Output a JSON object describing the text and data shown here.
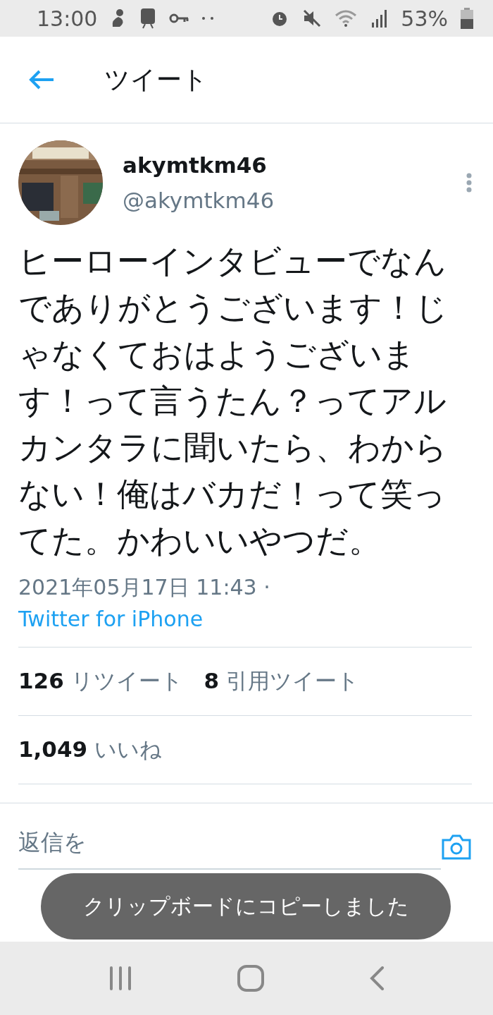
{
  "status_bar": {
    "time": "13:00",
    "battery": "53%"
  },
  "header": {
    "title": "ツイート"
  },
  "tweet": {
    "author": {
      "name": "akymtkm46",
      "handle": "@akymtkm46"
    },
    "text": "ヒーローインタビューでなんでありがとうございます！じゃなくておはようございます！って言うたん？ってアルカンタラに聞いたら、わからない！俺はバカだ！って笑ってた。かわいいやつだ。",
    "timestamp": "2021年05月17日 11:43 ·",
    "source": "Twitter for iPhone",
    "stats": [
      {
        "count": "126",
        "label": "リツイート"
      },
      {
        "count": "8",
        "label": "引用ツイート"
      }
    ],
    "likes": {
      "count": "1,049",
      "label": "いいね"
    }
  },
  "reply": {
    "placeholder": "返信を"
  },
  "toast": {
    "text": "クリップボードにコピーしました"
  }
}
